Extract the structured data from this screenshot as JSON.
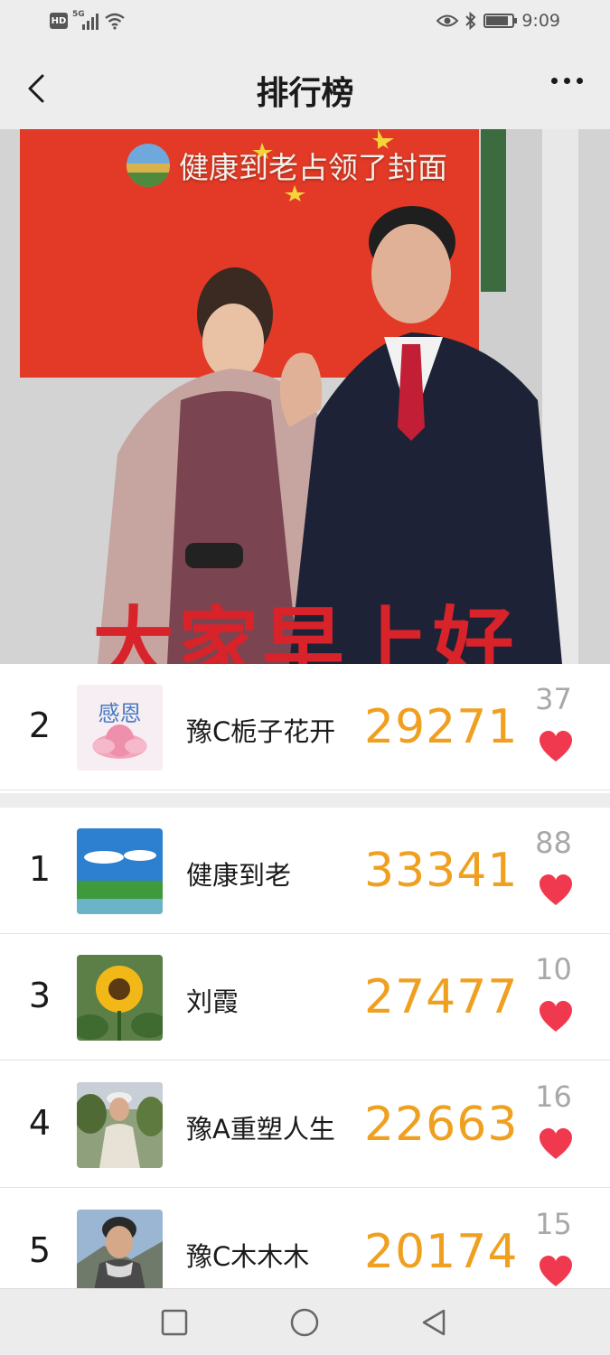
{
  "status_bar": {
    "hd_badge": "HD",
    "network": "5G",
    "time": "9:09",
    "battery_level": 0.85,
    "icons": [
      "hd-icon",
      "signal-icon",
      "wifi-icon",
      "eye-icon",
      "bluetooth-icon",
      "battery-icon"
    ]
  },
  "header": {
    "title": "排行榜",
    "back_icon": "chevron-left-icon",
    "more_icon": "more-dots-icon"
  },
  "cover": {
    "caption": "健康到老占领了封面",
    "greeting": "大家早上好"
  },
  "my_rank": {
    "rank": "2",
    "name": "豫C栀子花开",
    "avatar_text": "感恩",
    "steps": "29271",
    "likes": "37"
  },
  "ranking": [
    {
      "rank": "1",
      "name": "健康到老",
      "steps": "33341",
      "likes": "88"
    },
    {
      "rank": "3",
      "name": "刘霞",
      "steps": "27477",
      "likes": "10"
    },
    {
      "rank": "4",
      "name": "豫A重塑人生",
      "steps": "22663",
      "likes": "16"
    },
    {
      "rank": "5",
      "name": "豫C木木木",
      "steps": "20174",
      "likes": "15"
    }
  ],
  "colors": {
    "steps": "#f0a020",
    "heart": "#f0394e",
    "likes": "#a8a8a8",
    "header_bg": "#ededed"
  }
}
